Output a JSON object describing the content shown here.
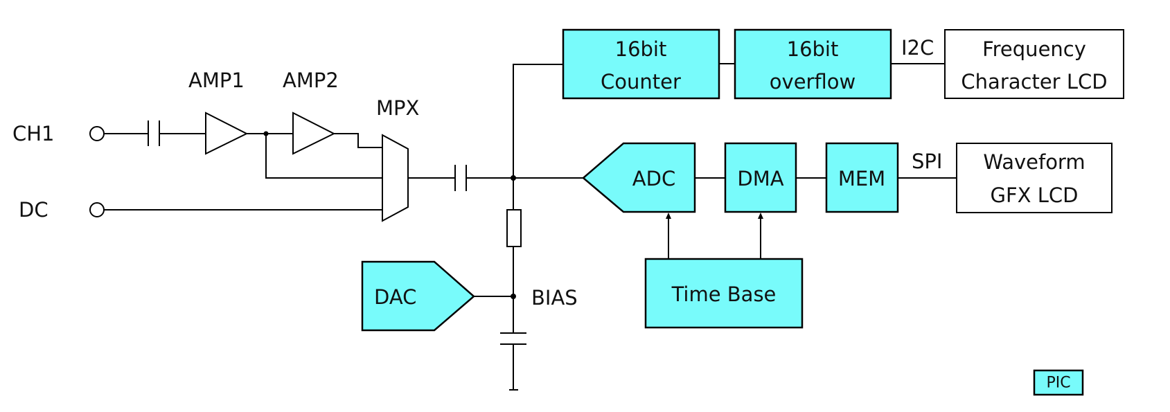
{
  "colors": {
    "block_fill": "#78fbfb",
    "line": "#000000",
    "background": "#ffffff"
  },
  "inputs": {
    "ch1": "CH1",
    "dc": "DC"
  },
  "amps": {
    "amp1": "AMP1",
    "amp2": "AMP2"
  },
  "mux": {
    "label": "MPX"
  },
  "bias": {
    "label": "BIAS"
  },
  "blocks": {
    "counter": {
      "line1": "16bit",
      "line2": "Counter"
    },
    "overflow": {
      "line1": "16bit",
      "line2": "overflow"
    },
    "freq_lcd": {
      "line1": "Frequency",
      "line2": "Character LCD"
    },
    "adc": "ADC",
    "dma": "DMA",
    "mem": "MEM",
    "wave_lcd": {
      "line1": "Waveform",
      "line2": "GFX LCD"
    },
    "dac": "DAC",
    "timebase": "Time Base",
    "pic": "PIC"
  },
  "buses": {
    "i2c": "I2C",
    "spi": "SPI"
  }
}
